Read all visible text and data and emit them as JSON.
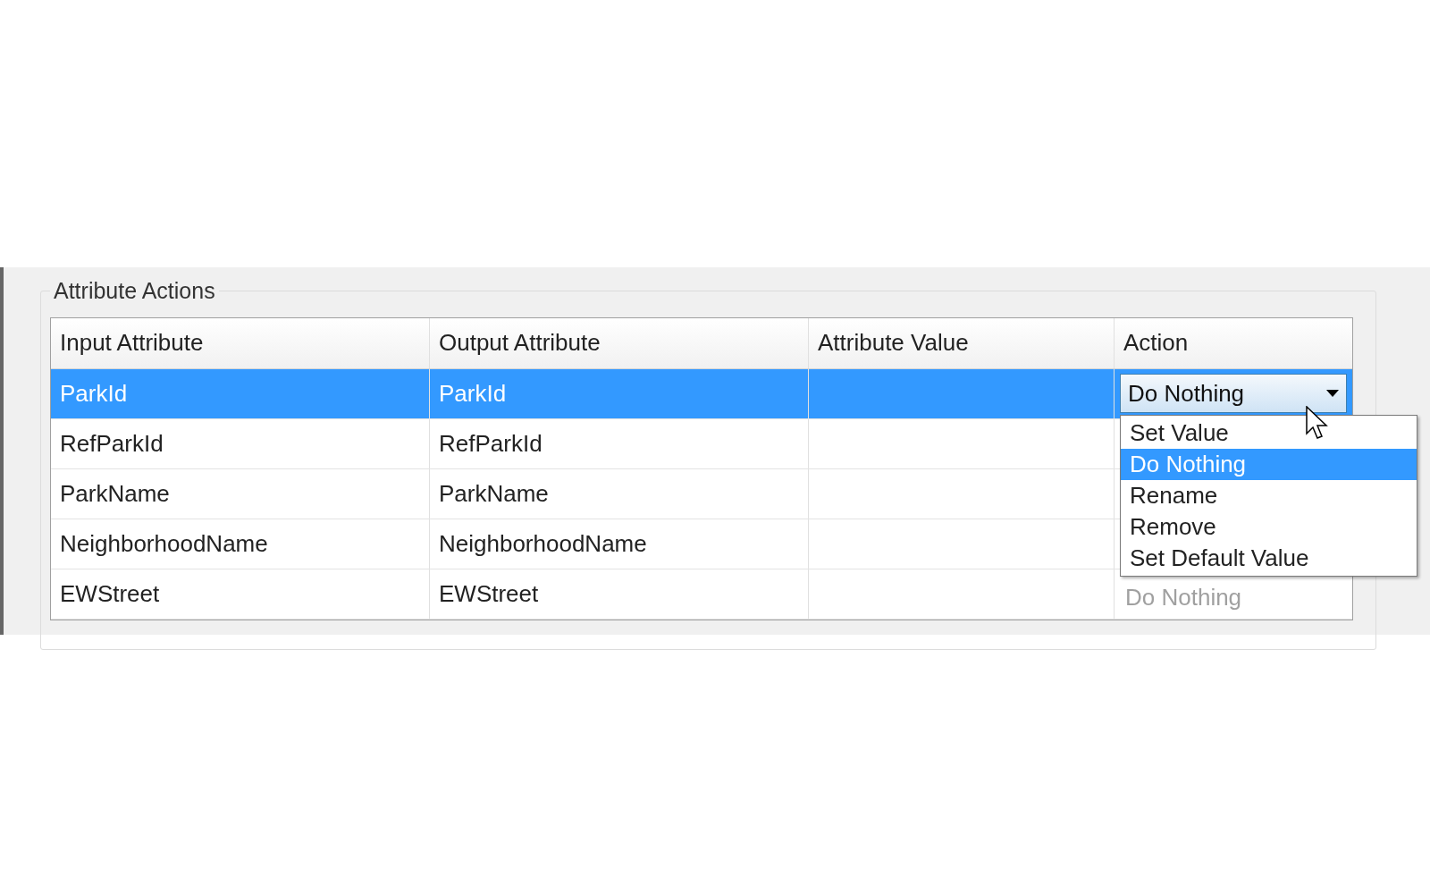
{
  "group": {
    "title": "Attribute Actions"
  },
  "table": {
    "columns": [
      "Input Attribute",
      "Output Attribute",
      "Attribute Value",
      "Action"
    ],
    "rows": [
      {
        "input_attribute": "ParkId",
        "output_attribute": "ParkId",
        "selected": true,
        "action": {
          "kind": "combo",
          "text": "Do Nothing"
        }
      },
      {
        "input_attribute": "RefParkId",
        "output_attribute": "RefParkId",
        "selected": false
      },
      {
        "input_attribute": "ParkName",
        "output_attribute": "ParkName",
        "selected": false
      },
      {
        "input_attribute": "NeighborhoodName",
        "output_attribute": "NeighborhoodName",
        "selected": false
      },
      {
        "input_attribute": "EWStreet",
        "output_attribute": "EWStreet",
        "selected": false,
        "action": {
          "kind": "text",
          "text": "Do Nothing"
        }
      }
    ]
  },
  "dropdown": {
    "options": [
      {
        "label": "Set Value",
        "selected": false
      },
      {
        "label": "Do Nothing",
        "selected": true
      },
      {
        "label": "Rename",
        "selected": false
      },
      {
        "label": "Remove",
        "selected": false
      },
      {
        "label": "Set Default Value",
        "selected": false
      }
    ]
  }
}
